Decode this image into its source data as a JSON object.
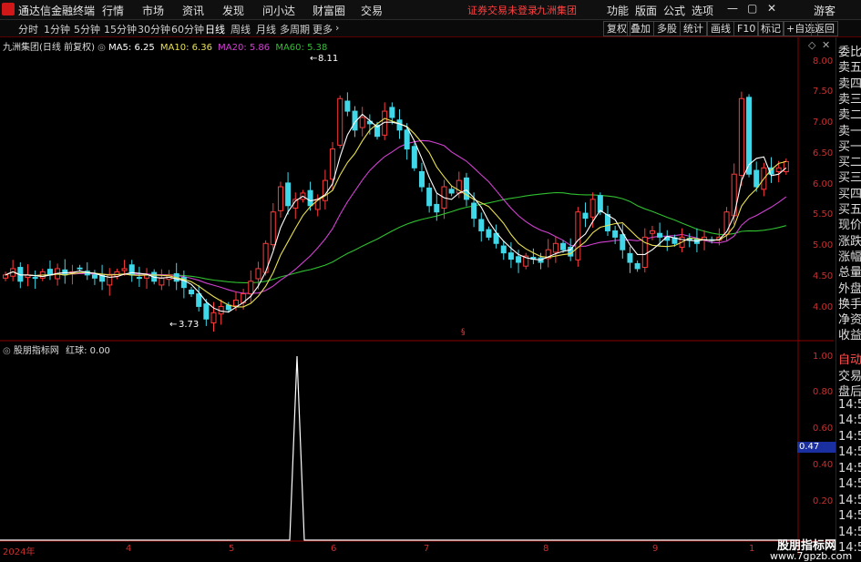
{
  "menubar": {
    "app_name": "通达信金融终端",
    "items": [
      "行情",
      "市场",
      "资讯",
      "发现",
      "问小达",
      "财富圈",
      "交易"
    ],
    "notice": "证券交易未登录",
    "stock_name": "九洲集团",
    "right_items": [
      "功能",
      "版面",
      "公式",
      "选项"
    ],
    "guest": "游客"
  },
  "toolbar": {
    "periods": [
      "分时",
      "1分钟",
      "5分钟",
      "15分钟",
      "30分钟",
      "60分钟",
      "日线",
      "周线",
      "月线",
      "多周期",
      "更多"
    ],
    "active_period": "日线",
    "right_buttons": [
      "复权",
      "叠加",
      "多股",
      "统计",
      "画线",
      "F10",
      "标记",
      "+自选",
      "返回"
    ]
  },
  "legend": {
    "title": "九洲集团(日线 前复权)",
    "ma5": "MA5: 6.25",
    "ma10": "MA10: 6.36",
    "ma20": "MA20: 5.86",
    "ma60": "MA60: 5.38"
  },
  "colors": {
    "ma5": "#ffffff",
    "ma10": "#e8e050",
    "ma20": "#d040d0",
    "ma60": "#30c030",
    "up": "#ff3a3a",
    "down": "#40d8e8",
    "grid": "#8a0000"
  },
  "price_axis": [
    "8.00",
    "7.50",
    "7.00",
    "6.50",
    "6.00",
    "5.50",
    "5.00",
    "4.50",
    "4.00"
  ],
  "high_label": "8.11",
  "low_label": "3.73",
  "sub_indicator": {
    "title": "股朋指标网",
    "value_label": "红球: 0.00",
    "axis": [
      "1.00",
      "0.80",
      "0.60",
      "0.47",
      "0.40",
      "0.20"
    ],
    "cursor_value": "0.47"
  },
  "x_axis": [
    "2024年",
    "4",
    "5",
    "6",
    "7",
    "8",
    "9",
    "1"
  ],
  "right_panel": {
    "top": [
      "委比",
      "卖五",
      "卖四",
      "卖三",
      "卖二",
      "卖一",
      "买一",
      "买二",
      "买三",
      "买四",
      "买五",
      "现价",
      "涨跌",
      "涨幅",
      "总量",
      "外盘",
      "换手",
      "净资",
      "收益"
    ],
    "bottom": [
      "自动",
      "交易",
      "盘后",
      "14:5",
      "14:5",
      "14:5",
      "14:5",
      "14:5",
      "14:5",
      "14:5",
      "14:5",
      "14:5",
      "14:5"
    ]
  },
  "watermark": {
    "line1": "股朋指标网",
    "line2": "www.7gpzb.com"
  },
  "chart_data": {
    "type": "candlestick",
    "title": "九洲集团(日线 前复权)",
    "ylim": [
      3.6,
      8.3
    ],
    "high": 8.11,
    "low": 3.73,
    "closes": [
      4.6,
      4.7,
      4.5,
      4.6,
      4.55,
      4.65,
      4.6,
      4.7,
      4.6,
      4.65,
      4.7,
      4.6,
      4.55,
      4.5,
      4.6,
      4.65,
      4.7,
      4.6,
      4.55,
      4.6,
      4.5,
      4.55,
      4.6,
      4.5,
      4.4,
      4.3,
      4.1,
      3.9,
      4.0,
      4.1,
      4.05,
      4.2,
      4.3,
      4.5,
      4.7,
      5.1,
      5.6,
      6.0,
      5.7,
      5.8,
      5.9,
      5.7,
      5.8,
      6.1,
      6.6,
      7.4,
      7.2,
      6.9,
      7.1,
      7.0,
      6.8,
      7.2,
      7.1,
      6.9,
      6.6,
      6.3,
      6.0,
      5.7,
      5.6,
      6.0,
      5.9,
      6.1,
      5.8,
      5.5,
      5.3,
      5.2,
      5.1,
      4.95,
      4.85,
      4.8,
      4.9,
      4.85,
      4.8,
      5.0,
      5.1,
      5.0,
      4.9,
      5.6,
      5.5,
      5.8,
      5.6,
      5.3,
      5.2,
      5.0,
      4.8,
      4.7,
      5.2,
      5.3,
      5.2,
      5.15,
      5.1,
      5.2,
      5.15,
      5.1,
      5.2,
      5.15,
      5.2,
      5.6,
      6.2,
      7.4,
      6.2,
      6.0,
      6.3,
      6.2,
      6.3,
      6.4
    ]
  }
}
